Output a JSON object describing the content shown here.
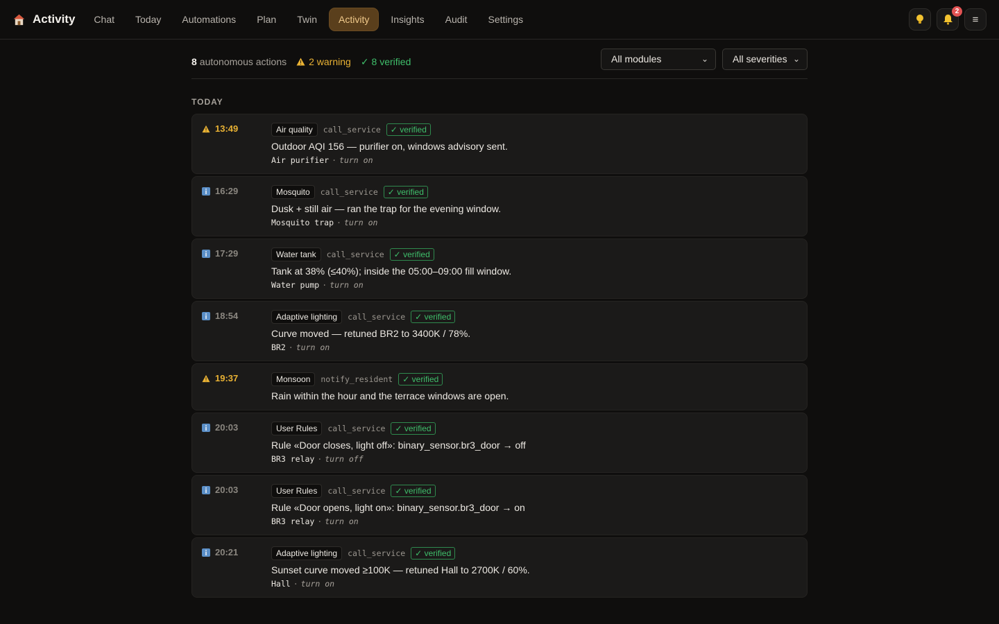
{
  "header": {
    "brand": "Activity",
    "nav": [
      "Chat",
      "Today",
      "Automations",
      "Plan",
      "Twin",
      "Activity",
      "Insights",
      "Audit",
      "Settings"
    ],
    "active_index": 5,
    "notif_count": "2"
  },
  "summary": {
    "count": "8",
    "count_label": "autonomous actions",
    "warning": "2 warning",
    "verified": "8 verified"
  },
  "filters": {
    "module": "All modules",
    "severity": "All severities"
  },
  "section": "TODAY",
  "actions": [
    {
      "sev": "warning",
      "time": "13:49",
      "module": "Air quality",
      "kind": "call_service",
      "status": "verified",
      "message": "Outdoor AQI 156 — purifier on, windows advisory sent.",
      "target": "Air purifier",
      "action": "turn on"
    },
    {
      "sev": "info",
      "time": "16:29",
      "module": "Mosquito",
      "kind": "call_service",
      "status": "verified",
      "message": "Dusk + still air — ran the trap for the evening window.",
      "target": "Mosquito trap",
      "action": "turn on"
    },
    {
      "sev": "info",
      "time": "17:29",
      "module": "Water tank",
      "kind": "call_service",
      "status": "verified",
      "message": "Tank at 38% (≤40%); inside the 05:00–09:00 fill window.",
      "target": "Water pump",
      "action": "turn on"
    },
    {
      "sev": "info",
      "time": "18:54",
      "module": "Adaptive lighting",
      "kind": "call_service",
      "status": "verified",
      "message": "Curve moved — retuned BR2 to 3400K / 78%.",
      "target": "BR2",
      "action": "turn on"
    },
    {
      "sev": "warning",
      "time": "19:37",
      "module": "Monsoon",
      "kind": "notify_resident",
      "status": "verified",
      "message": "Rain within the hour and the terrace windows are open.",
      "target": "",
      "action": ""
    },
    {
      "sev": "info",
      "time": "20:03",
      "module": "User Rules",
      "kind": "call_service",
      "status": "verified",
      "message": "Rule «Door closes, light off»: binary_sensor.br3_door → off",
      "target": "BR3 relay",
      "action": "turn off"
    },
    {
      "sev": "info",
      "time": "20:03",
      "module": "User Rules",
      "kind": "call_service",
      "status": "verified",
      "message": "Rule «Door opens, light on»: binary_sensor.br3_door → on",
      "target": "BR3 relay",
      "action": "turn on"
    },
    {
      "sev": "info",
      "time": "20:21",
      "module": "Adaptive lighting",
      "kind": "call_service",
      "status": "verified",
      "message": "Sunset curve moved ≥100K — retuned Hall to 2700K / 60%.",
      "target": "Hall",
      "action": "turn on"
    }
  ],
  "colors": {
    "accent": "#f0c98a",
    "warning": "#e9b234",
    "ok": "#3fbf6b",
    "info": "#5b8fc7"
  }
}
